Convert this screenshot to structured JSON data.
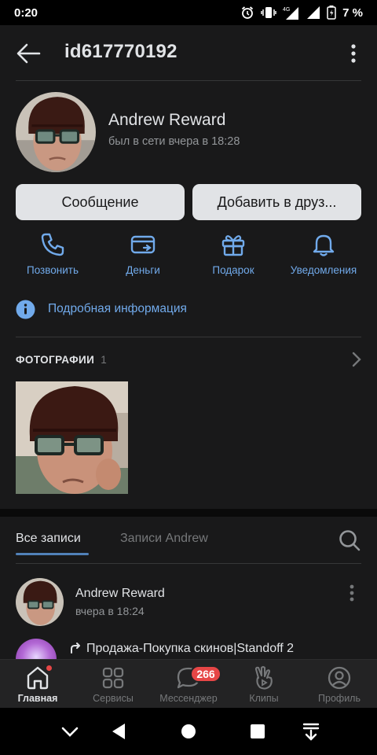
{
  "status": {
    "time": "0:20",
    "battery": "7 %",
    "network": "4G"
  },
  "header": {
    "title": "id617770192"
  },
  "profile": {
    "name": "Andrew Reward",
    "last_seen": "был в сети вчера в 18:28",
    "message_button": "Сообщение",
    "add_friend_button": "Добавить в друз..."
  },
  "actions": [
    {
      "label": "Позвонить",
      "icon": "phone-icon"
    },
    {
      "label": "Деньги",
      "icon": "money-icon"
    },
    {
      "label": "Подарок",
      "icon": "gift-icon"
    },
    {
      "label": "Уведомления",
      "icon": "bell-icon"
    }
  ],
  "info": {
    "label": "Подробная информация",
    "icon": "info-icon"
  },
  "photos": {
    "title": "ФОТОГРАФИИ",
    "count": "1"
  },
  "wall_tabs": {
    "all": "Все записи",
    "owner": "Записи Andrew"
  },
  "post": {
    "author": "Andrew Reward",
    "time": "вчера в 18:24",
    "repost_title": "Продажа-Покупка скинов|Standoff 2"
  },
  "tabbar": {
    "items": [
      {
        "label": "Главная",
        "icon": "home-icon",
        "active": true
      },
      {
        "label": "Сервисы",
        "icon": "services-icon"
      },
      {
        "label": "Мессенджер",
        "icon": "messenger-icon",
        "badge": "266"
      },
      {
        "label": "Клипы",
        "icon": "clips-icon"
      },
      {
        "label": "Профиль",
        "icon": "profile-icon"
      }
    ]
  },
  "colors": {
    "background": "#19191a",
    "accent": "#71aaeb",
    "button": "#e1e3e6",
    "badge": "#e64646"
  }
}
